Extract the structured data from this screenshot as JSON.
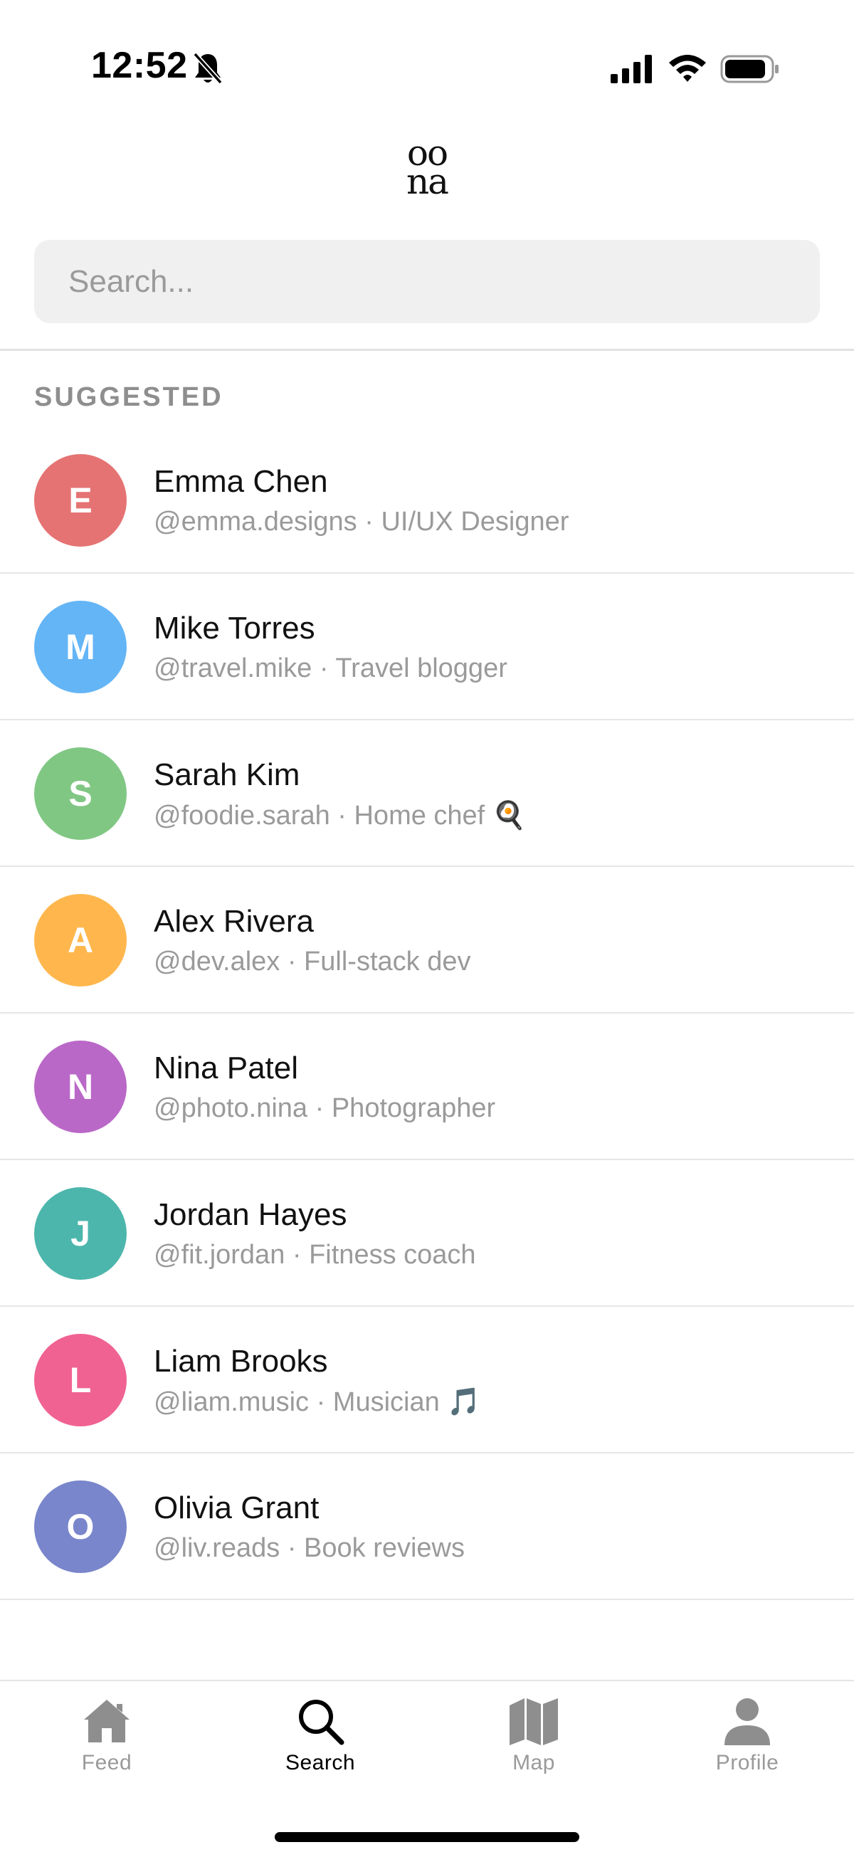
{
  "status_bar": {
    "time": "12:52",
    "icons": [
      "bell-slash-icon",
      "cellular-signal-icon",
      "wifi-icon",
      "battery-icon"
    ]
  },
  "logo": {
    "line1": "oo",
    "line2": "na"
  },
  "search": {
    "placeholder": "Search...",
    "value": ""
  },
  "suggested": {
    "heading": "SUGGESTED",
    "users": [
      {
        "initial": "E",
        "name": "Emma Chen",
        "subtitle": "@emma.designs · UI/UX Designer",
        "color": "#e57373"
      },
      {
        "initial": "M",
        "name": "Mike Torres",
        "subtitle": "@travel.mike · Travel blogger",
        "color": "#64b5f6"
      },
      {
        "initial": "S",
        "name": "Sarah Kim",
        "subtitle": "@foodie.sarah · Home chef 🍳",
        "color": "#81c784"
      },
      {
        "initial": "A",
        "name": "Alex Rivera",
        "subtitle": "@dev.alex · Full-stack dev",
        "color": "#ffb74d"
      },
      {
        "initial": "N",
        "name": "Nina Patel",
        "subtitle": "@photo.nina · Photographer",
        "color": "#ba68c8"
      },
      {
        "initial": "J",
        "name": "Jordan Hayes",
        "subtitle": "@fit.jordan · Fitness coach",
        "color": "#4db6ac"
      },
      {
        "initial": "L",
        "name": "Liam Brooks",
        "subtitle": "@liam.music · Musician 🎵",
        "color": "#f06292"
      },
      {
        "initial": "O",
        "name": "Olivia Grant",
        "subtitle": "@liv.reads · Book reviews",
        "color": "#7986cb"
      }
    ]
  },
  "bottom_nav": {
    "items": [
      {
        "label": "Feed",
        "icon": "home-icon",
        "active": false
      },
      {
        "label": "Search",
        "icon": "search-icon",
        "active": true
      },
      {
        "label": "Map",
        "icon": "map-icon",
        "active": false
      },
      {
        "label": "Profile",
        "icon": "person-icon",
        "active": false
      }
    ]
  }
}
